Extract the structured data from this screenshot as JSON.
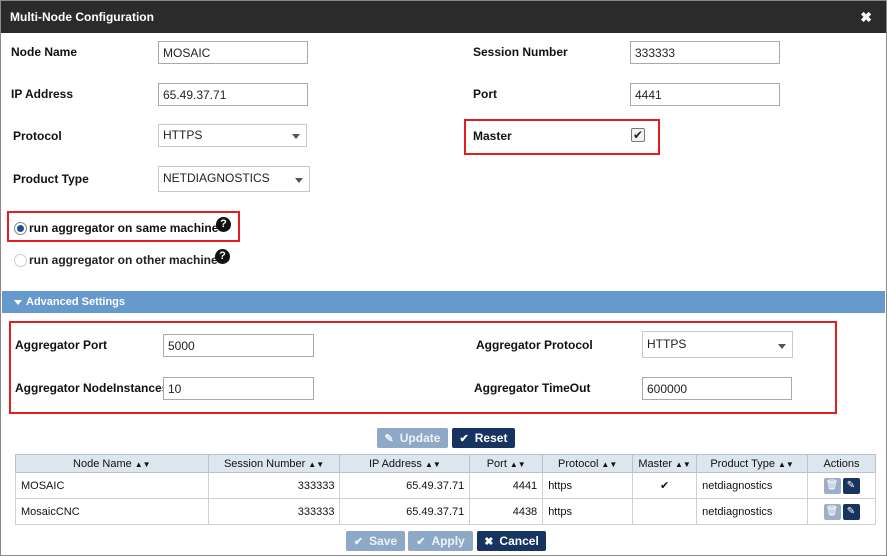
{
  "dialog": {
    "title": "Multi-Node Configuration",
    "close_icon": "close-icon"
  },
  "form": {
    "node_name_label": "Node Name",
    "node_name_value": "MOSAIC",
    "session_number_label": "Session Number",
    "session_number_value": "333333",
    "ip_address_label": "IP Address",
    "ip_address_value": "65.49.37.71",
    "port_label": "Port",
    "port_value": "4441",
    "protocol_label": "Protocol",
    "protocol_value": "HTTPS",
    "master_label": "Master",
    "master_checked": true,
    "product_type_label": "Product Type",
    "product_type_value": "NETDIAGNOSTICS",
    "radio_same_label": "run aggregator on same machine",
    "radio_other_label": "run aggregator on other machine",
    "help_icon": "question-circle-icon"
  },
  "advanced": {
    "section_label": "Advanced Settings",
    "aggregator_port_label": "Aggregator Port",
    "aggregator_port_value": "5000",
    "aggregator_protocol_label": "Aggregator Protocol",
    "aggregator_protocol_value": "HTTPS",
    "aggregator_nodeinstances_label": "Aggregator NodeInstances",
    "aggregator_nodeinstances_value": "10",
    "aggregator_timeout_label": "Aggregator TimeOut",
    "aggregator_timeout_value": "600000"
  },
  "buttons": {
    "update": "Update",
    "reset": "Reset",
    "save": "Save",
    "apply": "Apply",
    "cancel": "Cancel"
  },
  "table": {
    "columns": [
      "Node Name",
      "Session Number",
      "IP Address",
      "Port",
      "Protocol",
      "Master",
      "Product Type",
      "Actions"
    ],
    "rows": [
      {
        "node_name": "MOSAIC",
        "session_number": "333333",
        "ip_address": "65.49.37.71",
        "port": "4441",
        "protocol": "https",
        "master": "✔",
        "product_type": "netdiagnostics"
      },
      {
        "node_name": "MosaicCNC",
        "session_number": "333333",
        "ip_address": "65.49.37.71",
        "port": "4438",
        "protocol": "https",
        "master": "",
        "product_type": "netdiagnostics"
      }
    ]
  },
  "colors": {
    "title_bar": "#2b2b2b",
    "section_bar": "#6699cc",
    "primary_button": "#16345f",
    "highlight_box": "#e02020"
  }
}
